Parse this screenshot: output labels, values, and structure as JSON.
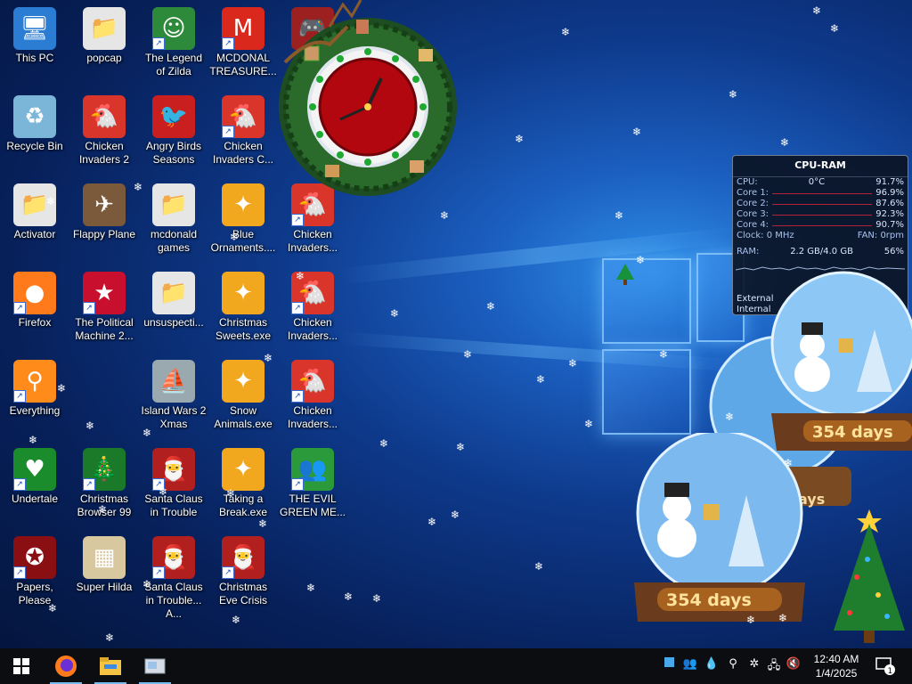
{
  "desktop_icons": [
    {
      "label": "This PC",
      "icon": "computer-icon",
      "shortcut": false
    },
    {
      "label": "Recycle Bin",
      "icon": "recycle-bin-icon",
      "shortcut": false
    },
    {
      "label": "Activator",
      "icon": "folder-icon",
      "shortcut": false
    },
    {
      "label": "Firefox",
      "icon": "firefox-icon",
      "shortcut": true
    },
    {
      "label": "Everything",
      "icon": "everything-search-icon",
      "shortcut": true
    },
    {
      "label": "Undertale",
      "icon": "undertale-icon",
      "shortcut": true
    },
    {
      "label": "Papers, Please",
      "icon": "papers-please-icon",
      "shortcut": true
    },
    {
      "label": "popcap",
      "icon": "folder-icon",
      "shortcut": false
    },
    {
      "label": "Chicken Invaders 2",
      "icon": "chicken-icon",
      "shortcut": false
    },
    {
      "label": "Flappy Plane",
      "icon": "plane-icon",
      "shortcut": false
    },
    {
      "label": "The Political Machine 2...",
      "icon": "political-machine-icon",
      "shortcut": true
    },
    {
      "label": "",
      "icon": "",
      "shortcut": false
    },
    {
      "label": "Christmas Browser 99",
      "icon": "christmas-tree-icon",
      "shortcut": true
    },
    {
      "label": "Super Hilda",
      "icon": "super-hilda-icon",
      "shortcut": false
    },
    {
      "label": "The Legend of Zilda",
      "icon": "zilda-icon",
      "shortcut": true
    },
    {
      "label": "Angry Birds Seasons",
      "icon": "angry-birds-icon",
      "shortcut": false
    },
    {
      "label": "mcdonald games",
      "icon": "folder-icon",
      "shortcut": false
    },
    {
      "label": "unsuspecti...",
      "icon": "folder-icon",
      "shortcut": false
    },
    {
      "label": "Island Wars 2 Xmas",
      "icon": "island-wars-icon",
      "shortcut": false
    },
    {
      "label": "Santa Claus in Trouble",
      "icon": "santa-icon",
      "shortcut": true
    },
    {
      "label": "Santa Claus in Trouble... A...",
      "icon": "santa-icon",
      "shortcut": true
    },
    {
      "label": "MCDONAL TREASURE...",
      "icon": "mcdonalds-icon",
      "shortcut": true
    },
    {
      "label": "Chicken Invaders C...",
      "icon": "chicken-icon",
      "shortcut": true
    },
    {
      "label": "Blue Ornaments....",
      "icon": "exe-icon",
      "shortcut": false
    },
    {
      "label": "Christmas Sweets.exe",
      "icon": "exe-icon",
      "shortcut": false
    },
    {
      "label": "Snow Animals.exe",
      "icon": "exe-icon",
      "shortcut": false
    },
    {
      "label": "Taking a Break.exe",
      "icon": "exe-icon",
      "shortcut": false
    },
    {
      "label": "Christmas Eve Crisis",
      "icon": "santa-icon",
      "shortcut": true
    },
    {
      "label": "",
      "icon": "game-icon",
      "shortcut": false
    },
    {
      "label": "",
      "icon": "",
      "shortcut": false
    },
    {
      "label": "Chicken Invaders...",
      "icon": "chicken-icon",
      "shortcut": true
    },
    {
      "label": "Chicken Invaders...",
      "icon": "chicken-icon",
      "shortcut": true
    },
    {
      "label": "Chicken Invaders...",
      "icon": "chicken-icon",
      "shortcut": true
    },
    {
      "label": "THE EVIL GREEN ME...",
      "icon": "messenger-icon",
      "shortcut": true
    },
    {
      "label": "",
      "icon": "",
      "shortcut": false
    }
  ],
  "cpu_gadget": {
    "title": "CPU-RAM",
    "cpu_label": "CPU:",
    "temp": "0°C",
    "cpu_total": "91.7%",
    "cores": [
      {
        "label": "Core 1:",
        "value": "96.9%"
      },
      {
        "label": "Core 2:",
        "value": "87.6%"
      },
      {
        "label": "Core 3:",
        "value": "92.3%"
      },
      {
        "label": "Core 4:",
        "value": "90.7%"
      }
    ],
    "clock": "Clock: 0 MHz",
    "fan": "FAN: 0rpm",
    "ram_label": "RAM:",
    "ram_used": "2.2 GB/4.0 GB",
    "ram_pct": "56%",
    "net_external": "External",
    "net_internal": "Internal"
  },
  "snow_globes": {
    "countdown_top": "354 days",
    "countdown_bottom": "354 days",
    "partial": "ays"
  },
  "taskbar": {
    "time": "12:40 AM",
    "date": "1/4/2025",
    "notifications": "1",
    "apps": [
      "firefox-icon",
      "file-explorer-icon",
      "snipping-tool-icon"
    ]
  },
  "colors": {
    "taskbar": "#0b0d11",
    "accent": "#76b9ed",
    "clock_face": "#b3070f"
  }
}
